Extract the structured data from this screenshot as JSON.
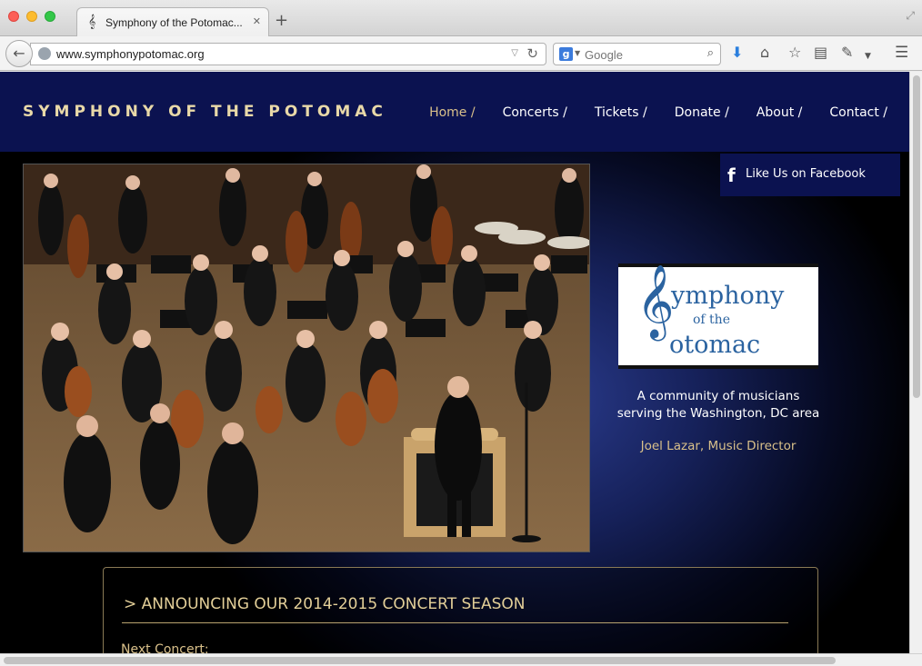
{
  "browser": {
    "tab_title": "Symphony of the Potomac...",
    "tab_icon": "treble-clef-icon",
    "new_tab_label": "+",
    "url": "www.symphonypotomac.org",
    "search_placeholder": "Google",
    "search_engine_letter": "g"
  },
  "site": {
    "logo": "SYMPHONY OF THE POTOMAC",
    "nav": [
      {
        "label": "Home /",
        "active": true
      },
      {
        "label": "Concerts /"
      },
      {
        "label": "Tickets /"
      },
      {
        "label": "Donate /"
      },
      {
        "label": "About /"
      },
      {
        "label": "Contact /"
      }
    ],
    "facebook": {
      "icon": "f",
      "label": "Like Us on Facebook"
    },
    "logo_card": {
      "clef": "𝄞",
      "line1": "ymphony",
      "line2": "of the",
      "line3": "otomac"
    },
    "tagline_line1": "A community of musicians",
    "tagline_line2": "serving the Washington, DC area",
    "director": "Joel Lazar, Music Director",
    "announcement": {
      "title": "> ANNOUNCING OUR 2014-2015 CONCERT SEASON",
      "next_label": "Next Concert:"
    }
  },
  "colors": {
    "header_bg": "#0b1250",
    "gold": "#d9c08a",
    "logo_blue": "#2b63a0"
  }
}
